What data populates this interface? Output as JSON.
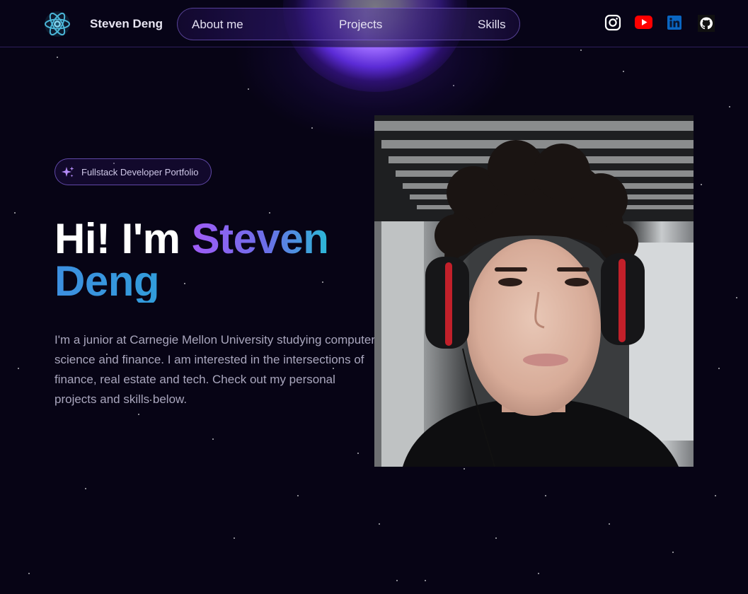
{
  "header": {
    "brand": "Steven Deng",
    "nav": [
      {
        "label": "About me"
      },
      {
        "label": "Projects"
      },
      {
        "label": "Skills"
      }
    ],
    "social": [
      "instagram-icon",
      "youtube-icon",
      "linkedin-icon",
      "github-icon"
    ]
  },
  "hero": {
    "badge": "Fullstack Developer Portfolio",
    "greeting": "Hi! I'm ",
    "name_first": "Steven",
    "name_last": "Deng",
    "bio": "I'm a junior at Carnegie Mellon University studying computer science and finance. I am interested in the intersections of finance, real estate and tech. Check out my personal projects and skills below."
  },
  "colors": {
    "background": "#070415",
    "accent_purple": "#a05cf6",
    "accent_cyan": "#1fb3d2",
    "youtube_red": "#ff0000",
    "linkedin_blue": "#0a66c2"
  }
}
